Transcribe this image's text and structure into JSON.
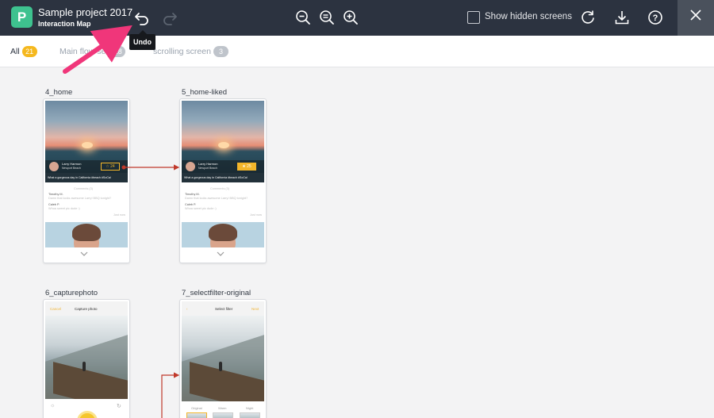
{
  "header": {
    "project_title": "Sample project 2017",
    "subtitle": "Interaction Map",
    "logo_letter": "P",
    "show_hidden_label": "Show hidden screens",
    "undo_tooltip": "Undo"
  },
  "tabs": [
    {
      "label": "All",
      "count": "21",
      "active": true
    },
    {
      "label": "Main flow set",
      "count": "18",
      "active": false
    },
    {
      "label": "scrolling screen",
      "count": "3",
      "active": false
    }
  ],
  "screens": [
    {
      "name": "4_home",
      "user_name": "Larry Harmon",
      "user_place": "Newport Beach",
      "caption": "What a gorgeous day in California #beach #SoCal",
      "like_text": "☆ 24",
      "comments_header": "Comments (3)",
      "comments": [
        {
          "author": "Timothy M.",
          "text": "Damn that looks awesome Larry! BBQ tonight?"
        },
        {
          "author": "Caleb P.",
          "text": "Whoa sweet pic dude :)"
        }
      ],
      "time": "Just now"
    },
    {
      "name": "5_home-liked",
      "user_name": "Larry Harmon",
      "user_place": "Newport Beach",
      "caption": "What a gorgeous day in California #beach #SoCal",
      "like_text": "★ 25",
      "comments_header": "Comments (3)",
      "comments": [
        {
          "author": "Timothy M.",
          "text": "Damn that looks awesome Larry! BBQ tonight?"
        },
        {
          "author": "Caleb P.",
          "text": "Whoa sweet pic dude :)"
        }
      ],
      "time": "Just now"
    },
    {
      "name": "6_capturephoto",
      "left_action": "Cancel",
      "title": "Capture photo"
    },
    {
      "name": "7_selectfilter-original",
      "left_action": "‹",
      "title": "Select filter",
      "right_action": "Next",
      "filters": [
        "Original",
        "Warm",
        "Night"
      ]
    }
  ],
  "colors": {
    "topbar": "#2c3340",
    "accent_yellow": "#f5b81e",
    "link_red": "#c0392b",
    "logo_green": "#3ec28f"
  },
  "icons": {
    "undo": "undo-icon",
    "redo": "redo-icon",
    "zoom_out": "zoom-out-icon",
    "zoom_reset": "zoom-reset-icon",
    "zoom_in": "zoom-in-icon",
    "refresh": "refresh-icon",
    "download": "download-icon",
    "help": "help-icon",
    "close": "close-icon"
  }
}
